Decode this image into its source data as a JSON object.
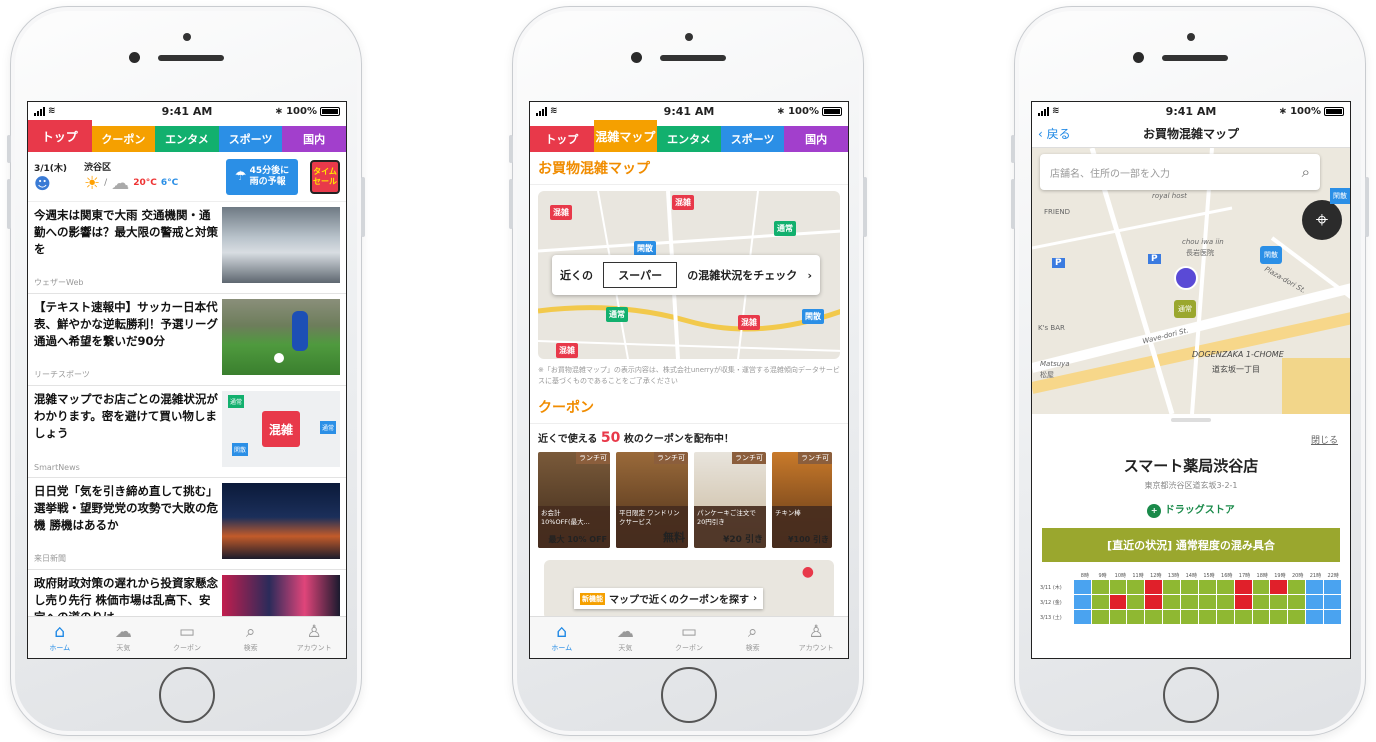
{
  "status": {
    "time": "9:41 AM",
    "battery": "100%"
  },
  "colors": {
    "red": "#e8394a",
    "orange": "#f5a000",
    "green": "#12b06e",
    "blue": "#2b8fe6",
    "purple": "#a23fcc",
    "crowd_green": "#8fb832",
    "crowd_red": "#e0202a",
    "crowd_blue": "#4aa3f0"
  },
  "tabbar": [
    {
      "label": "ホーム",
      "icon": "home-icon",
      "glyph": "⌂"
    },
    {
      "label": "天気",
      "icon": "weather-icon",
      "glyph": "☁"
    },
    {
      "label": "クーポン",
      "icon": "coupon-icon",
      "glyph": "▭"
    },
    {
      "label": "検索",
      "icon": "search-icon",
      "glyph": "⌕"
    },
    {
      "label": "アカウント",
      "icon": "account-icon",
      "glyph": "♙"
    }
  ],
  "phone1": {
    "tabs": [
      "トップ",
      "クーポン",
      "エンタメ",
      "スポーツ",
      "国内"
    ],
    "weather": {
      "date": "3/1(木)",
      "place": "渋谷区",
      "temp_high": "20°C",
      "temp_low": "6°C",
      "rain_line1": "45分後に",
      "rain_line2": "雨の予報",
      "sale_line1": "タイム",
      "sale_line2": "セール"
    },
    "news": [
      {
        "headline": "今週末は関東で大雨 交通機関・通勤への影響は？最大限の警戒と対策を",
        "source": "ウェザーWeb"
      },
      {
        "headline": "【テキスト速報中】サッカー日本代表、鮮やかな逆転勝利！予選リーグ通過へ希望を繋いだ90分",
        "source": "リーチスポーツ"
      },
      {
        "headline": "混雑マップでお店ごとの混雑状況がわかります。密を避けて買い物しましょう",
        "source": "SmartNews",
        "thumb_label": "混雑",
        "thumb_pins": [
          "通常",
          "通常",
          "閑散"
        ]
      },
      {
        "headline": "日日党「気を引き締め直して挑む」選挙戦・望野党党の攻勢で大敗の危機 勝機はあるか",
        "source": "来日新聞"
      },
      {
        "headline": "政府財政対策の遅れから投資家懸念し売り先行 株価市場は乱高下、安定への道のりは",
        "source": ""
      }
    ]
  },
  "phone2": {
    "tabs": [
      "トップ",
      "混雑マップ",
      "エンタメ",
      "スポーツ",
      "国内"
    ],
    "map_title": "お買物混雑マップ",
    "pins": [
      {
        "label": "混雑"
      },
      {
        "label": "混雑"
      },
      {
        "label": "通常"
      },
      {
        "label": "閑散"
      },
      {
        "label": "通常"
      },
      {
        "label": "混雑"
      },
      {
        "label": "閑散"
      },
      {
        "label": "混雑"
      }
    ],
    "check_prefix": "近くの",
    "check_select": "スーパー",
    "check_suffix": "の混雑状況をチェック",
    "disclaimer": "※「お買物混雑マップ」の表示内容は、株式会社unerryが収集・運営する混雑傾向データサービスに基づくものであることをご了承ください",
    "coupon_title": "クーポン",
    "coupon_lead_pre": "近くで使える",
    "coupon_count": "50",
    "coupon_lead_post": "枚のクーポンを配布中！",
    "coupons": [
      {
        "tag": "ランチ可",
        "desc1": "お会計",
        "desc2": "10%OFF(最大...",
        "price": "最大 10% OFF"
      },
      {
        "tag": "ランチ可",
        "desc1": "平日限定 ワンドリン",
        "desc2": "クサービス",
        "price": "無料"
      },
      {
        "tag": "ランチ可",
        "desc1": "パンケーキご注文で",
        "desc2": "20円引き",
        "price": "¥20 引き"
      },
      {
        "tag": "ランチ可",
        "desc1": "チキン棒",
        "desc2": "",
        "price": "¥100 引き"
      }
    ],
    "new_badge": "新機能",
    "coupon_map_link": "マップで近くのクーポンを探す"
  },
  "phone3": {
    "back": "戻る",
    "title": "お買物混雑マップ",
    "search_placeholder": "店舗名、住所の一部を入力",
    "map_labels": [
      "royal host",
      "FRIEND",
      "chou iwa iin",
      "長岩医院",
      "K's BAR",
      "Matsuya",
      "松屋",
      "DOGENZAKA 1-CHOME",
      "道玄坂一丁目",
      "Wave-dori St.",
      "Plaza-dori St.",
      "閑散",
      "通常",
      "閑散"
    ],
    "close": "閉じる",
    "store_name": "スマート薬局渋谷店",
    "store_address": "東京都渋谷区道玄坂3-2-1",
    "store_category": "ドラッグストア",
    "crowd_status": "[直近の状況] 通常程度の混み具合",
    "hours": [
      "8時",
      "9時",
      "10時",
      "11時",
      "12時",
      "13時",
      "14時",
      "15時",
      "16時",
      "17時",
      "18時",
      "19時",
      "20時",
      "21時",
      "22時"
    ],
    "days": [
      {
        "date": "3/11 (木)",
        "levels": [
          "b",
          "g",
          "g",
          "g",
          "r",
          "g",
          "g",
          "g",
          "g",
          "r",
          "g",
          "r",
          "g",
          "b",
          "b"
        ]
      },
      {
        "date": "3/12 (金)",
        "levels": [
          "b",
          "g",
          "r",
          "g",
          "r",
          "g",
          "g",
          "g",
          "g",
          "r",
          "g",
          "g",
          "g",
          "b",
          "b"
        ]
      },
      {
        "date": "3/13 (土)",
        "levels": [
          "b",
          "g",
          "g",
          "g",
          "g",
          "g",
          "g",
          "g",
          "g",
          "g",
          "g",
          "g",
          "g",
          "b",
          "b"
        ]
      }
    ]
  }
}
